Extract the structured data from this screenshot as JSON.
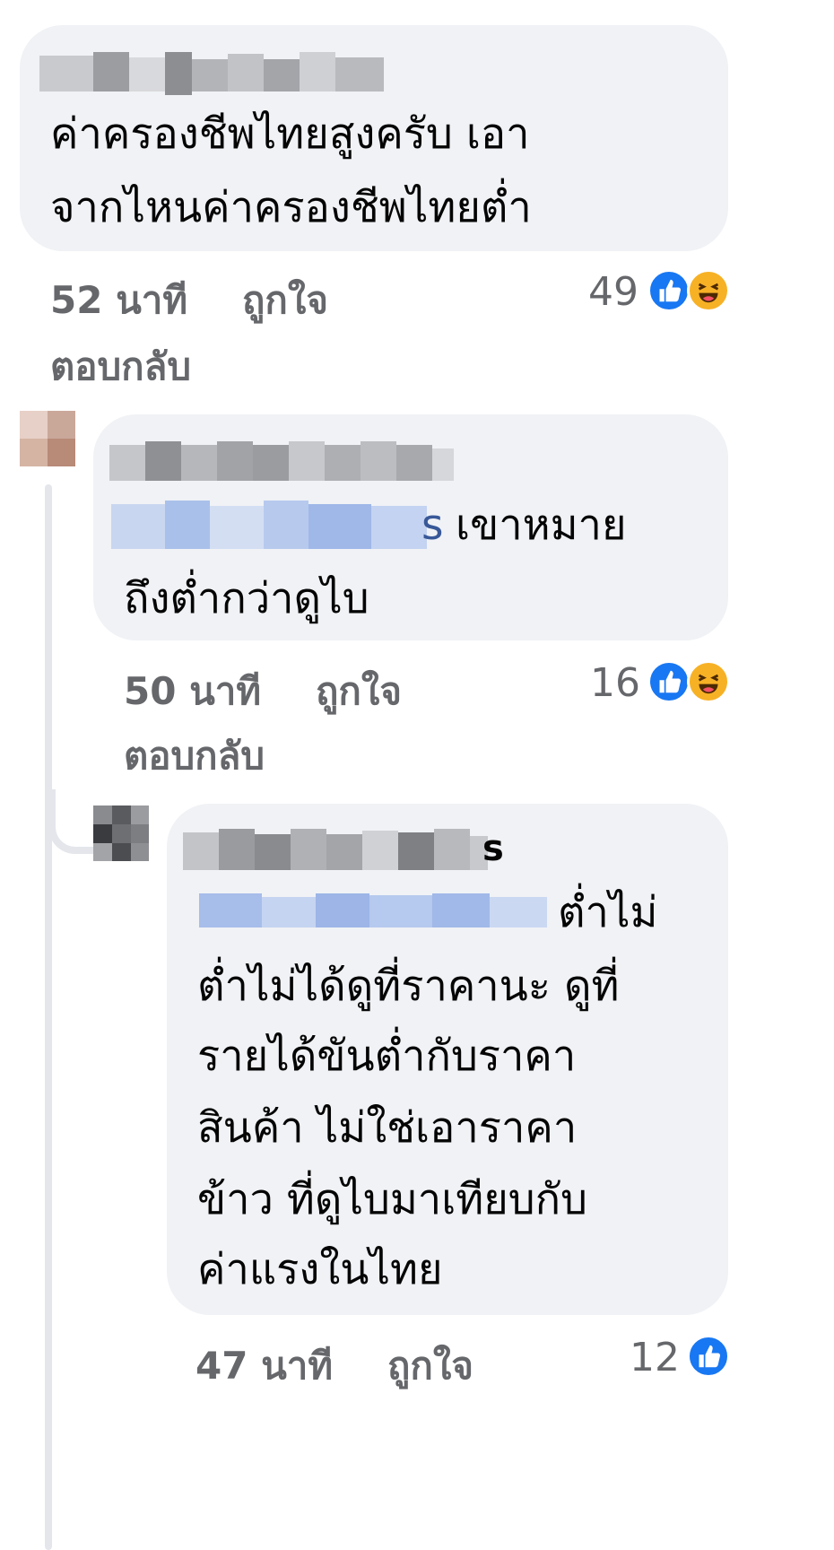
{
  "comments": [
    {
      "text_lines": [
        "ค่าครองชีพไทยสูงครับ  เอา",
        "จากไหนค่าครองชีพไทยต่ำ"
      ],
      "time": "52 นาที",
      "like_label": "ถูกใจ",
      "reply_label": "ตอบกลับ",
      "reaction_count": "49",
      "reactions": [
        "like-icon",
        "haha-icon"
      ]
    },
    {
      "tag_suffix": "s",
      "text_lines": [
        "เขาหมาย",
        "ถึงต่ำกว่าดูไบ"
      ],
      "time": "50 นาที",
      "like_label": "ถูกใจ",
      "reply_label": "ตอบกลับ",
      "reaction_count": "16",
      "reactions": [
        "like-icon",
        "haha-icon"
      ]
    },
    {
      "name_suffix": "s",
      "text_lines": [
        "ต่ำไม่",
        "ต่ำไม่ได้ดูที่ราคานะ  ดูที่",
        "รายได้ขันต่ำกับราคา",
        "สินค้า  ไม่ใช่เอาราคา",
        "ข้าว ที่ดูไบมาเทียบกับ",
        "ค่าแรงในไทย"
      ],
      "time": "47 นาที",
      "like_label": "ถูกใจ",
      "reaction_count": "12",
      "reactions": [
        "like-icon"
      ]
    }
  ],
  "colors": {
    "bubble": "#f0f2f5",
    "meta_text": "#65676b",
    "like_blue": "#1877f2",
    "haha_yellow": "#f7b125",
    "mention_blue": "#385898"
  }
}
